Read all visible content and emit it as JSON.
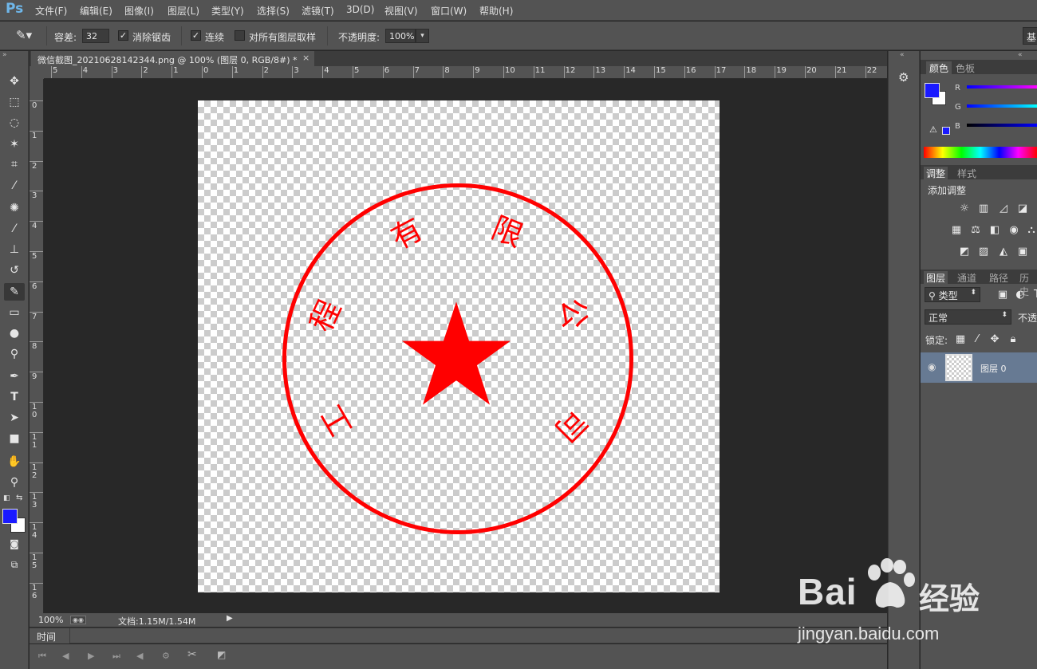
{
  "app": {
    "logo": "Ps"
  },
  "menu": [
    "文件(F)",
    "编辑(E)",
    "图像(I)",
    "图层(L)",
    "类型(Y)",
    "选择(S)",
    "滤镜(T)",
    "3D(D)",
    "视图(V)",
    "窗口(W)",
    "帮助(H)"
  ],
  "options": {
    "tolerance_label": "容差:",
    "tolerance_value": "32",
    "antialias_label": "消除锯齿",
    "contiguous_label": "连续",
    "all_layers_label": "对所有图层取样",
    "opacity_label": "不透明度:",
    "opacity_value": "100%",
    "workspace_label": "基"
  },
  "document": {
    "tab_title": "微信截图_20210628142344.png @ 100% (图层 0, RGB/8#) *",
    "ruler_top": [
      "5",
      "4",
      "3",
      "2",
      "1",
      "0",
      "1",
      "2",
      "3",
      "4",
      "5",
      "6",
      "7",
      "8",
      "9",
      "10",
      "11",
      "12",
      "13",
      "14",
      "15",
      "16",
      "17",
      "18",
      "19",
      "20",
      "21",
      "22"
    ],
    "ruler_left": [
      "0",
      "1",
      "2",
      "3",
      "4",
      "5",
      "6",
      "7",
      "8",
      "9",
      "1 0",
      "1 1",
      "1 2",
      "1 3",
      "1 4",
      "1 5",
      "1 6"
    ],
    "seal_chars": {
      "top_left": "有",
      "top_right": "限",
      "right": "公",
      "bottom_right": "司",
      "left": "程",
      "bottom_left": "工"
    },
    "seal_color": "#ff0000"
  },
  "status": {
    "zoom": "100%",
    "doc_size": "文档:1.15M/1.54M"
  },
  "timeline": {
    "label": "时间轴"
  },
  "panels": {
    "color_tabs": [
      "颜色",
      "色板"
    ],
    "channels": [
      "R",
      "G",
      "B"
    ],
    "foreground_color": "#1a1aff",
    "adjust_tabs": [
      "调整",
      "样式"
    ],
    "add_adjust_label": "添加调整",
    "layers_tabs": [
      "图层",
      "通道",
      "路径",
      "历史"
    ],
    "filter_kind": "类型",
    "blend_mode": "正常",
    "opacity_short": "不透",
    "lock_label": "锁定:",
    "layer_name": "图层 0"
  },
  "watermark": {
    "brand": "Bai",
    "brand_cn": "经验",
    "url": "jingyan.baidu.com"
  }
}
